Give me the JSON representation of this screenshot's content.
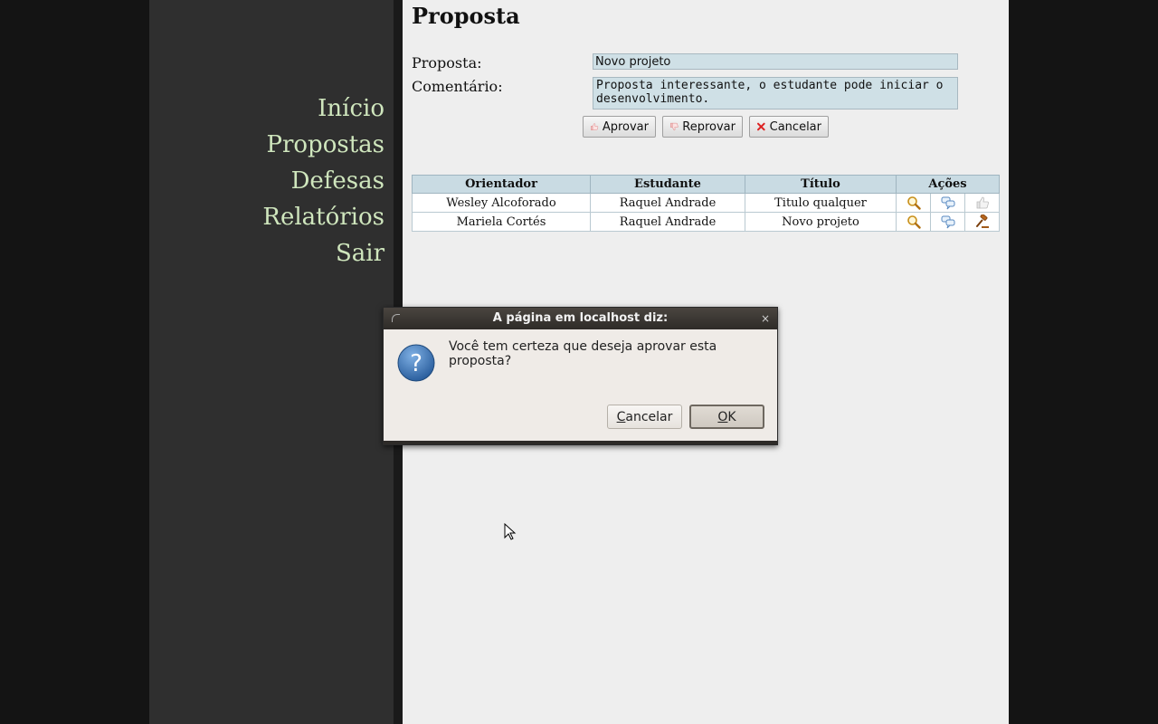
{
  "nav": {
    "items": [
      "Início",
      "Propostas",
      "Defesas",
      "Relatórios",
      "Sair"
    ]
  },
  "page": {
    "title": "Proposta"
  },
  "form": {
    "proposta_label": "Proposta:",
    "proposta_value": "Novo projeto",
    "comentario_label": "Comentário:",
    "comentario_value": "Proposta interessante, o estudante pode iniciar o desenvolvimento."
  },
  "buttons": {
    "aprovar": "Aprovar",
    "reprovar": "Reprovar",
    "cancelar": "Cancelar"
  },
  "table": {
    "headers": [
      "Orientador",
      "Estudante",
      "Título",
      "Ações"
    ],
    "rows": [
      {
        "orientador": "Wesley Alcoforado",
        "estudante": "Raquel Andrade",
        "titulo": "Titulo qualquer",
        "actions": [
          "view-icon",
          "comment-icon",
          "approve-icon"
        ]
      },
      {
        "orientador": "Mariela Cortés",
        "estudante": "Raquel Andrade",
        "titulo": "Novo projeto",
        "actions": [
          "view-icon",
          "comment-icon",
          "gavel-icon"
        ]
      }
    ]
  },
  "dialog": {
    "title": "A página em localhost diz:",
    "message": "Você tem certeza que deseja aprovar esta proposta?",
    "cancel_first": "C",
    "cancel_rest": "ancelar",
    "ok_first": "O",
    "ok_rest": "K",
    "close_glyph": "×"
  },
  "colors": {
    "nav_text": "#cfe6bd",
    "sidebar_bg": "#2f2f2f",
    "content_bg": "#eeeeee",
    "table_header": "#c9dbe3",
    "input_bg": "#cfe0e6"
  }
}
